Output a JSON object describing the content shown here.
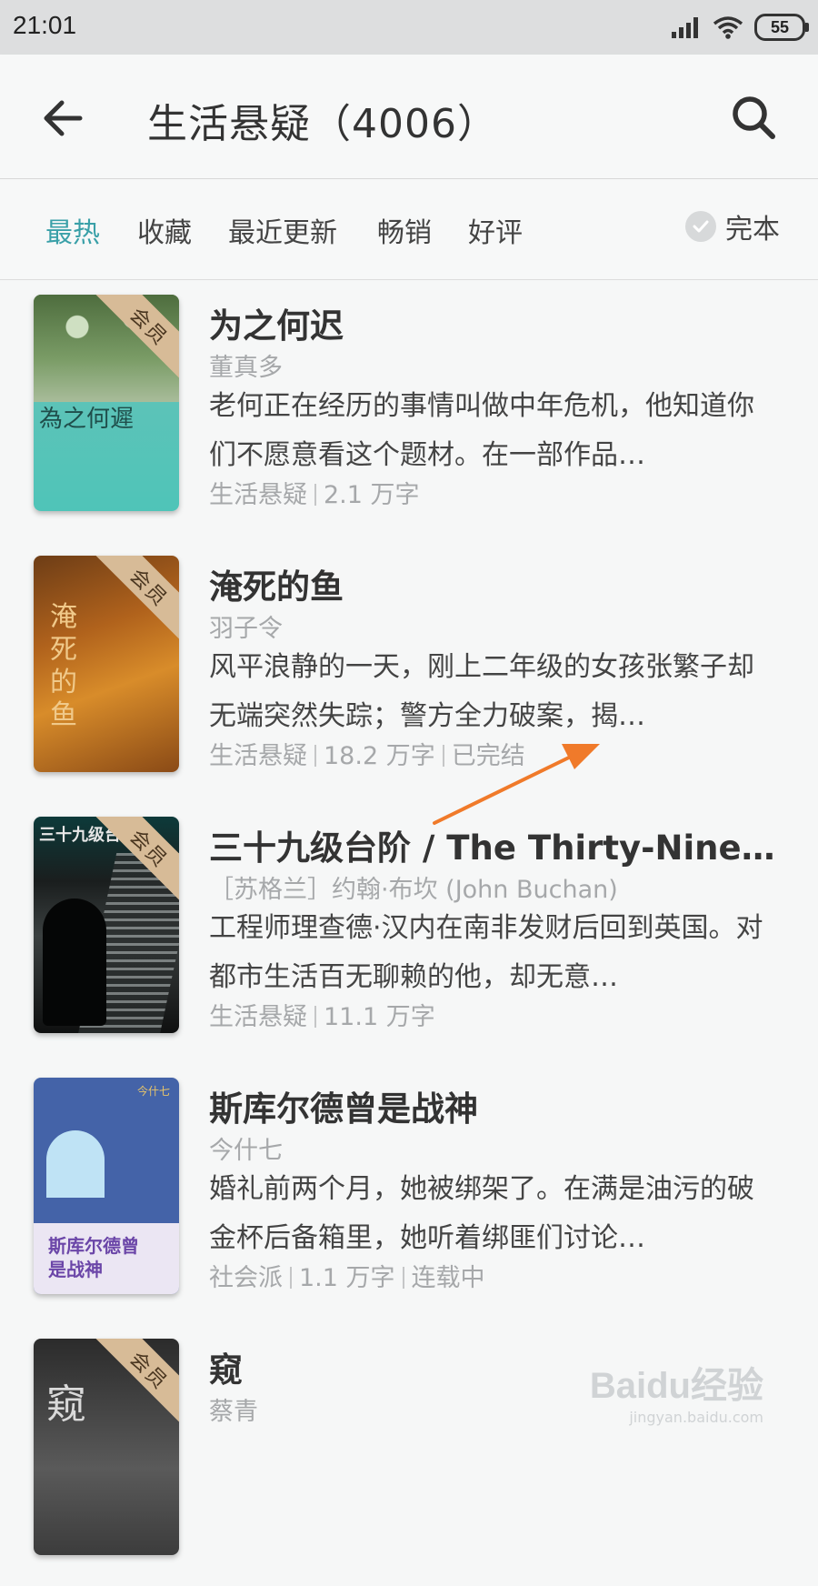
{
  "status_bar": {
    "time": "21:01",
    "battery": "55"
  },
  "header": {
    "title": "生活悬疑（4006）"
  },
  "filters": {
    "tabs": [
      {
        "label": "最热",
        "active": true
      },
      {
        "label": "收藏",
        "active": false
      },
      {
        "label": "最近更新",
        "active": false
      },
      {
        "label": "畅销",
        "active": false
      },
      {
        "label": "好评",
        "active": false
      }
    ],
    "complete_label": "完本",
    "accent_color": "#3aa0a8"
  },
  "books": [
    {
      "title": "为之何迟",
      "author": "董真多",
      "description": "老何正在经历的事情叫做中年危机，他知道你们不愿意看这个题材。在一部作品…",
      "meta": [
        "生活悬疑",
        "2.1 万字"
      ],
      "member_badge": "会员",
      "cover_text": "為之何遲"
    },
    {
      "title": "淹死的鱼",
      "author": "羽子令",
      "description": "风平浪静的一天，刚上二年级的女孩张繁子却无端突然失踪；警方全力破案，揭…",
      "meta": [
        "生活悬疑",
        "18.2 万字",
        "已完结"
      ],
      "member_badge": "会员",
      "cover_text": "淹死的鱼"
    },
    {
      "title": "三十九级台阶 / The Thirty-Nine S…",
      "author": "［苏格兰］约翰·布坎 (John Buchan)",
      "description": "工程师理查德·汉内在南非发财后回到英国。对都市生活百无聊赖的他，却无意…",
      "meta": [
        "生活悬疑",
        "11.1 万字"
      ],
      "member_badge": "会员",
      "cover_text": "三十九级台阶"
    },
    {
      "title": "斯库尔德曾是战神",
      "author": "今什七",
      "description": "婚礼前两个月，她被绑架了。在满是油污的破金杯后备箱里，她听着绑匪们讨论…",
      "meta": [
        "社会派",
        "1.1 万字",
        "连载中"
      ],
      "member_badge": "",
      "cover_text": "斯库尔德曾\n是战神",
      "cover_top_text": "今什七"
    },
    {
      "title": "窥",
      "author": "蔡青",
      "description": "",
      "meta": [],
      "member_badge": "会员",
      "cover_text": "窥"
    }
  ],
  "watermark": {
    "logo": "Baidu经验",
    "url": "jingyan.baidu.com"
  },
  "annotation": {
    "arrow_color": "#f07a2a"
  }
}
